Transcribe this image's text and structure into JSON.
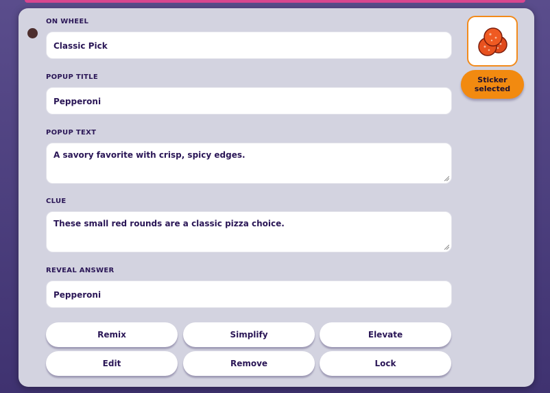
{
  "fields": {
    "on_wheel": {
      "label": "ON WHEEL",
      "value": "Classic Pick"
    },
    "popup_title": {
      "label": "POPUP TITLE",
      "value": "Pepperoni"
    },
    "popup_text": {
      "label": "POPUP TEXT",
      "value": "A savory favorite with crisp, spicy edges."
    },
    "clue": {
      "label": "CLUE",
      "value": "These small red rounds are a classic pizza choice."
    },
    "reveal_answer": {
      "label": "REVEAL ANSWER",
      "value": "Pepperoni"
    }
  },
  "actions": {
    "remix": "Remix",
    "simplify": "Simplify",
    "elevate": "Elevate",
    "edit": "Edit",
    "remove": "Remove",
    "lock": "Lock"
  },
  "sticker": {
    "icon": "pepperoni-icon",
    "badge_line1": "Sticker",
    "badge_line2": "selected"
  },
  "colors": {
    "accent": "#f28a10",
    "text": "#2a1656",
    "card": "#d3d3e0"
  }
}
